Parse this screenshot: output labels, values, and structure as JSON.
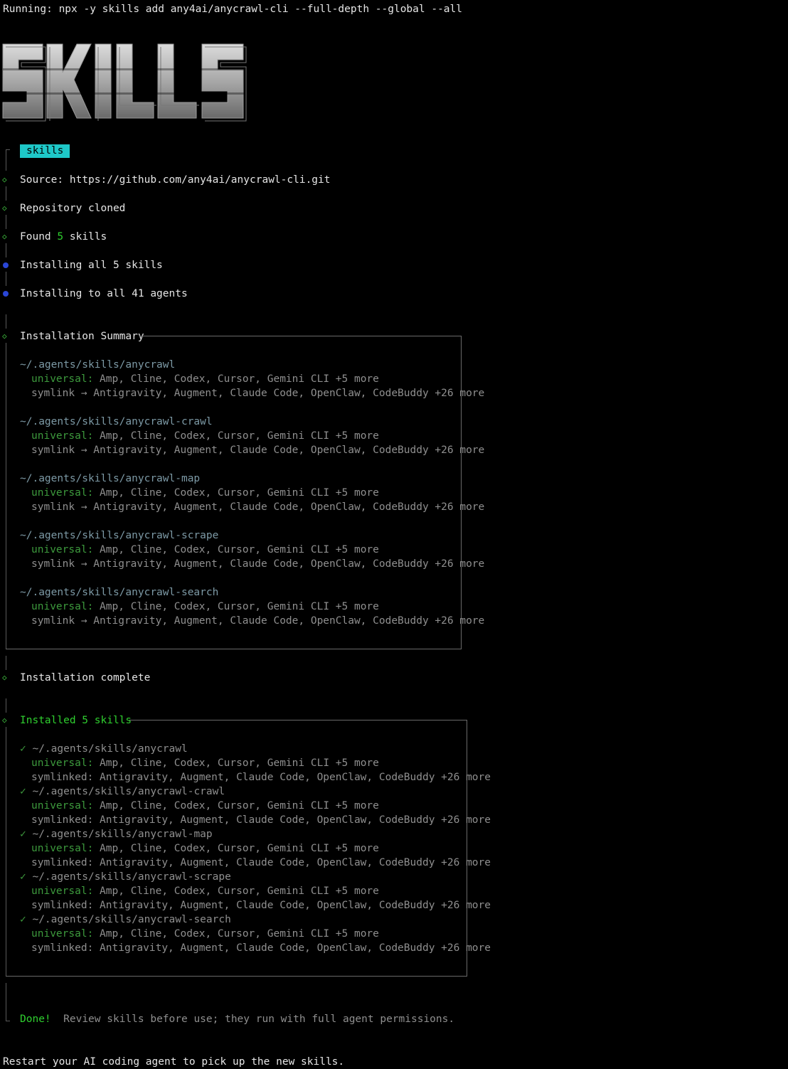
{
  "header": {
    "command": "Running: npx -y skills add any4ai/anycrawl-cli --full-depth --global --all",
    "logo_text": "SKILLS"
  },
  "status": {
    "tag": "skills",
    "source": "Source: https://github.com/any4ai/anycrawl-cli.git",
    "cloned": "Repository cloned",
    "found_prefix": "Found ",
    "found_count": "5",
    "found_suffix": " skills",
    "installing_skills": "Installing all 5 skills",
    "installing_agents": "Installing to all 41 agents"
  },
  "summary": {
    "title": "Installation Summary",
    "items": [
      {
        "path": "~/.agents/skills/anycrawl",
        "universal_label": "universal:",
        "universal": " Amp, Cline, Codex, Cursor, Gemini CLI +5 more",
        "symlink": "symlink → Antigravity, Augment, Claude Code, OpenClaw, CodeBuddy +26 more"
      },
      {
        "path": "~/.agents/skills/anycrawl-crawl",
        "universal_label": "universal:",
        "universal": " Amp, Cline, Codex, Cursor, Gemini CLI +5 more",
        "symlink": "symlink → Antigravity, Augment, Claude Code, OpenClaw, CodeBuddy +26 more"
      },
      {
        "path": "~/.agents/skills/anycrawl-map",
        "universal_label": "universal:",
        "universal": " Amp, Cline, Codex, Cursor, Gemini CLI +5 more",
        "symlink": "symlink → Antigravity, Augment, Claude Code, OpenClaw, CodeBuddy +26 more"
      },
      {
        "path": "~/.agents/skills/anycrawl-scrape",
        "universal_label": "universal:",
        "universal": " Amp, Cline, Codex, Cursor, Gemini CLI +5 more",
        "symlink": "symlink → Antigravity, Augment, Claude Code, OpenClaw, CodeBuddy +26 more"
      },
      {
        "path": "~/.agents/skills/anycrawl-search",
        "universal_label": "universal:",
        "universal": " Amp, Cline, Codex, Cursor, Gemini CLI +5 more",
        "symlink": "symlink → Antigravity, Augment, Claude Code, OpenClaw, CodeBuddy +26 more"
      }
    ]
  },
  "complete": "Installation complete",
  "installed": {
    "title": "Installed 5 skills",
    "check": "✓",
    "items": [
      {
        "path": "~/.agents/skills/anycrawl",
        "universal_label": "universal:",
        "universal": " Amp, Cline, Codex, Cursor, Gemini CLI +5 more",
        "symlinked": "symlinked: Antigravity, Augment, Claude Code, OpenClaw, CodeBuddy +26 more"
      },
      {
        "path": "~/.agents/skills/anycrawl-crawl",
        "universal_label": "universal:",
        "universal": " Amp, Cline, Codex, Cursor, Gemini CLI +5 more",
        "symlinked": "symlinked: Antigravity, Augment, Claude Code, OpenClaw, CodeBuddy +26 more"
      },
      {
        "path": "~/.agents/skills/anycrawl-map",
        "universal_label": "universal:",
        "universal": " Amp, Cline, Codex, Cursor, Gemini CLI +5 more",
        "symlinked": "symlinked: Antigravity, Augment, Claude Code, OpenClaw, CodeBuddy +26 more"
      },
      {
        "path": "~/.agents/skills/anycrawl-scrape",
        "universal_label": "universal:",
        "universal": " Amp, Cline, Codex, Cursor, Gemini CLI +5 more",
        "symlinked": "symlinked: Antigravity, Augment, Claude Code, OpenClaw, CodeBuddy +26 more"
      },
      {
        "path": "~/.agents/skills/anycrawl-search",
        "universal_label": "universal:",
        "universal": " Amp, Cline, Codex, Cursor, Gemini CLI +5 more",
        "symlinked": "symlinked: Antigravity, Augment, Claude Code, OpenClaw, CodeBuddy +26 more"
      }
    ]
  },
  "footer": {
    "done": "Done!",
    "note": "Review skills before use; they run with full agent permissions.",
    "restart": "Restart your AI coding agent to pick up the new skills."
  }
}
